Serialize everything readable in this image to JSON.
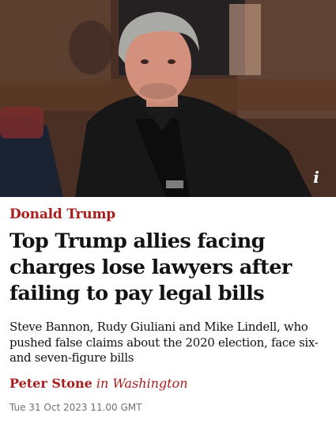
{
  "article": {
    "kicker": "Donald Trump",
    "headline": "Top Trump allies facing charges lose lawyers after failing to pay legal bills",
    "standfirst": "Steve Bannon, Rudy Giuliani and Mike Lindell, who pushed false claims about the 2020 election, face six- and seven-figure bills",
    "byline": {
      "author": "Peter Stone",
      "location": "in Washington"
    },
    "date": "Tue 31 Oct 2023 11.00 GMT"
  },
  "hero": {
    "info_icon": "i",
    "info_icon_name": "info-icon"
  },
  "colors": {
    "accent": "#a91c1c",
    "text": "#121212",
    "meta": "#707070"
  }
}
